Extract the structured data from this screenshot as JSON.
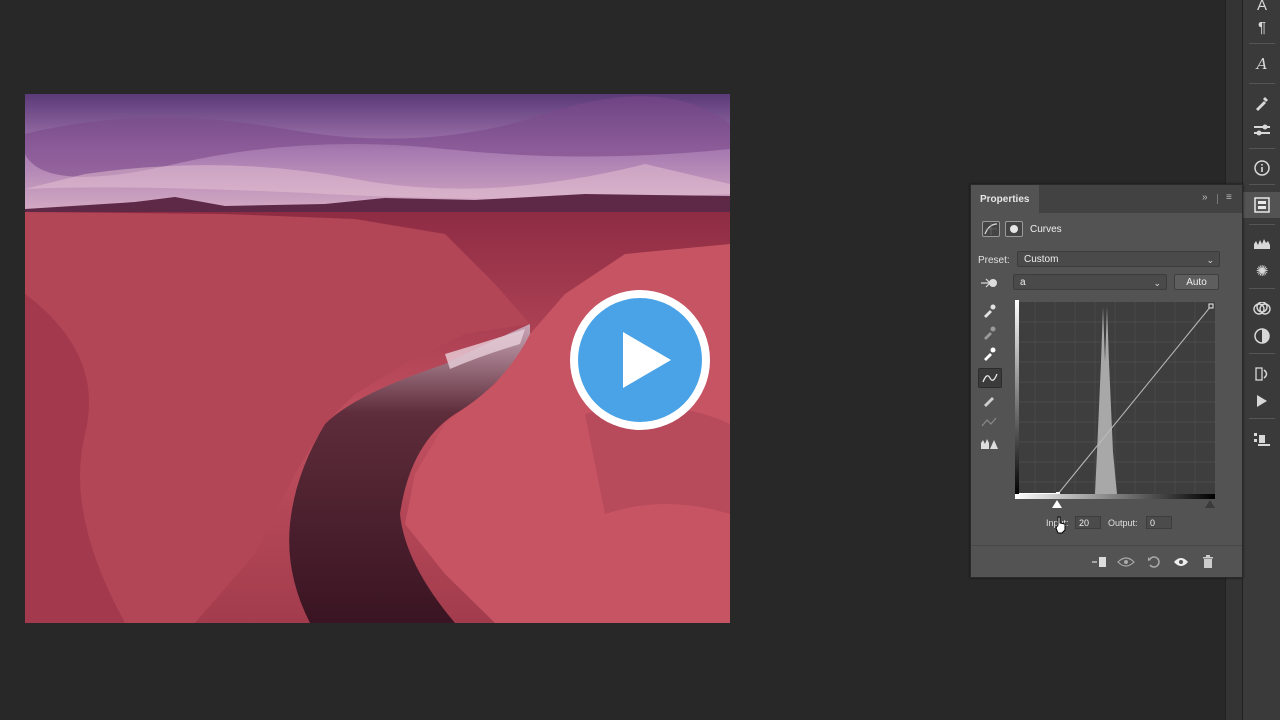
{
  "canvas": {
    "play_button_color": "#3b9de0"
  },
  "properties_panel": {
    "title": "Properties",
    "collapse_glyph": "»",
    "menu_glyph": "≡",
    "adjustment_name": "Curves",
    "preset_label": "Preset:",
    "preset_value": "Custom",
    "channel_value": "a",
    "auto_label": "Auto",
    "input_label": "Input:",
    "input_value": "20",
    "output_label": "Output:",
    "output_value": "0"
  },
  "right_toolbar": {
    "icons": [
      "character-icon",
      "paragraph-icon",
      "glyphs-icon",
      "brush-icon",
      "brush-settings-icon",
      "info-icon",
      "properties-icon",
      "levels-icon",
      "adjustments-icon",
      "channels-icon",
      "color-icon",
      "history-icon",
      "actions-icon",
      "clone-source-icon"
    ]
  },
  "colors": {
    "accent": "#3b9de0",
    "panel_bg": "#535353",
    "app_bg": "#282828"
  }
}
